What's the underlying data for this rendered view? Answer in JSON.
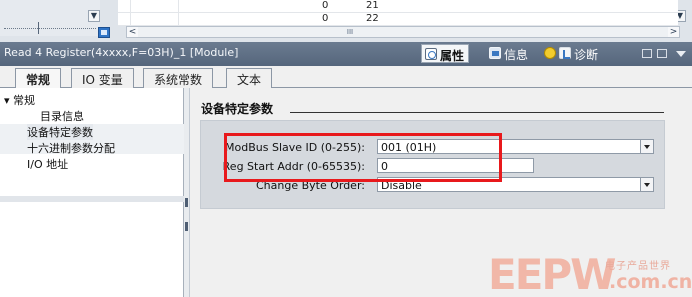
{
  "top_table": {
    "rows": [
      {
        "col1": "0",
        "col2": "21"
      },
      {
        "col1": "0",
        "col2": "22"
      }
    ],
    "scroll_thumb": "III"
  },
  "module": {
    "title": "Read 4 Register(4xxxx,F=03H)_1 [Module]",
    "panel_tabs": [
      "属性",
      "信息",
      "诊断"
    ]
  },
  "tabs": [
    "常规",
    "IO 变量",
    "系统常数",
    "文本"
  ],
  "tree": {
    "group": "常规",
    "children": [
      "目录信息",
      "设备特定参数",
      "十六进制参数分配",
      "I/O 地址"
    ]
  },
  "content": {
    "section_title": "设备特定参数",
    "fields": [
      {
        "label": "ModBus Slave ID (0-255):",
        "value": "001 (01H)",
        "kind": "dropdown"
      },
      {
        "label": "Reg Start Addr (0-65535):",
        "value": "0",
        "kind": "text"
      },
      {
        "label": "Change Byte Order:",
        "value": "Disable",
        "kind": "dropdown"
      }
    ]
  },
  "watermark": {
    "brand": "EEPW",
    "chinese": "电子产品世界",
    "domain": ".com.cn"
  },
  "colors": {
    "title_bar": "#55667c",
    "highlight_box": "#e8191c",
    "param_box": "#d5d9de"
  }
}
